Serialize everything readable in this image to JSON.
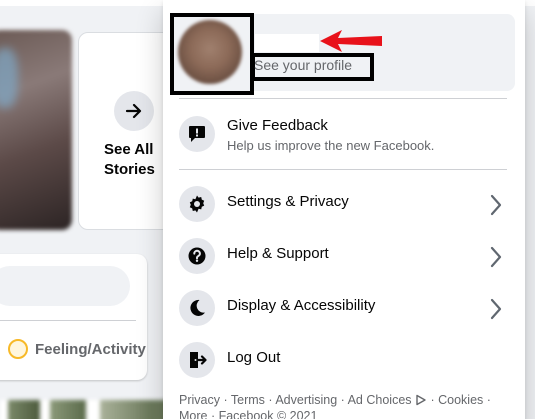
{
  "background": {
    "stories": {
      "see_all_label": "See All Stories",
      "arrow_icon": "arrow-right-icon"
    },
    "composer": {
      "feeling_label": "Feeling/Activity",
      "feeling_icon": "smiley-icon"
    }
  },
  "menu": {
    "profile": {
      "name": "",
      "subtitle": "See your profile"
    },
    "feedback": {
      "label": "Give Feedback",
      "sub": "Help us improve the new Facebook.",
      "icon": "feedback-icon"
    },
    "items": [
      {
        "label": "Settings & Privacy",
        "icon": "gear-icon",
        "has_chevron": true
      },
      {
        "label": "Help & Support",
        "icon": "help-icon",
        "has_chevron": true
      },
      {
        "label": "Display & Accessibility",
        "icon": "moon-icon",
        "has_chevron": true
      },
      {
        "label": "Log Out",
        "icon": "logout-icon",
        "has_chevron": false
      }
    ],
    "footer": {
      "privacy": "Privacy",
      "terms": "Terms",
      "advertising": "Advertising",
      "ad_choices": "Ad Choices",
      "cookies": "Cookies",
      "more": "More",
      "copyright": "Facebook © 2021",
      "separator": " · "
    }
  },
  "colors": {
    "icon_bg": "#e4e6eb",
    "secondary_text": "#65676b",
    "annotation_red": "#e8121a",
    "annotation_box": "#000000"
  }
}
